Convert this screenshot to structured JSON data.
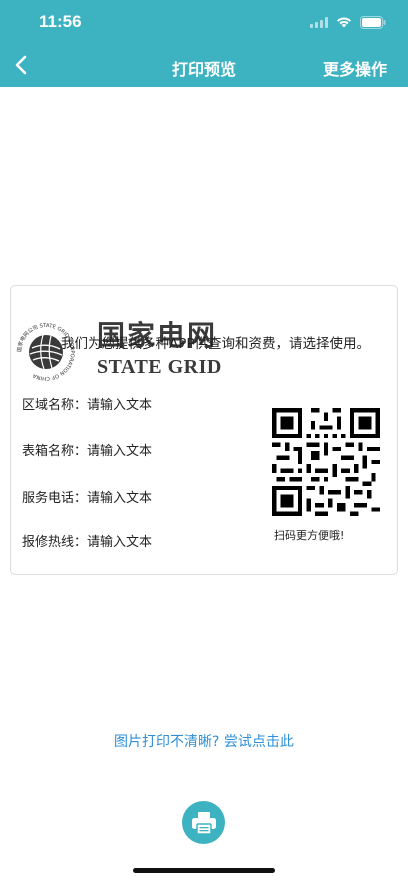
{
  "status_bar": {
    "time": "11:56"
  },
  "nav": {
    "title": "打印预览",
    "more_label": "更多操作"
  },
  "card": {
    "logo_ring_text": "国家电网公司 STATE GRID CORPORATION OF CHINA",
    "brand_cn": "国家电网",
    "brand_en": "STATE GRID",
    "overlay_text": "我们为您提供多种APP供查询和资费，请选择使用。",
    "rows": [
      {
        "label": "区域名称：",
        "value": "请输入文本"
      },
      {
        "label": "表箱名称：",
        "value": "请输入文本"
      },
      {
        "label": "服务电话：",
        "value": "请输入文本"
      },
      {
        "label": "报修热线：",
        "value": "请输入文本"
      }
    ],
    "qr_caption": "扫码更方便哦!"
  },
  "tip_link": "图片打印不清晰? 尝试点击此",
  "colors": {
    "accent": "#3db3c2",
    "link": "#2f8fd8"
  },
  "icons": [
    "back-arrow-icon",
    "signal-icon",
    "wifi-icon",
    "battery-icon",
    "printer-icon",
    "qr-code"
  ]
}
